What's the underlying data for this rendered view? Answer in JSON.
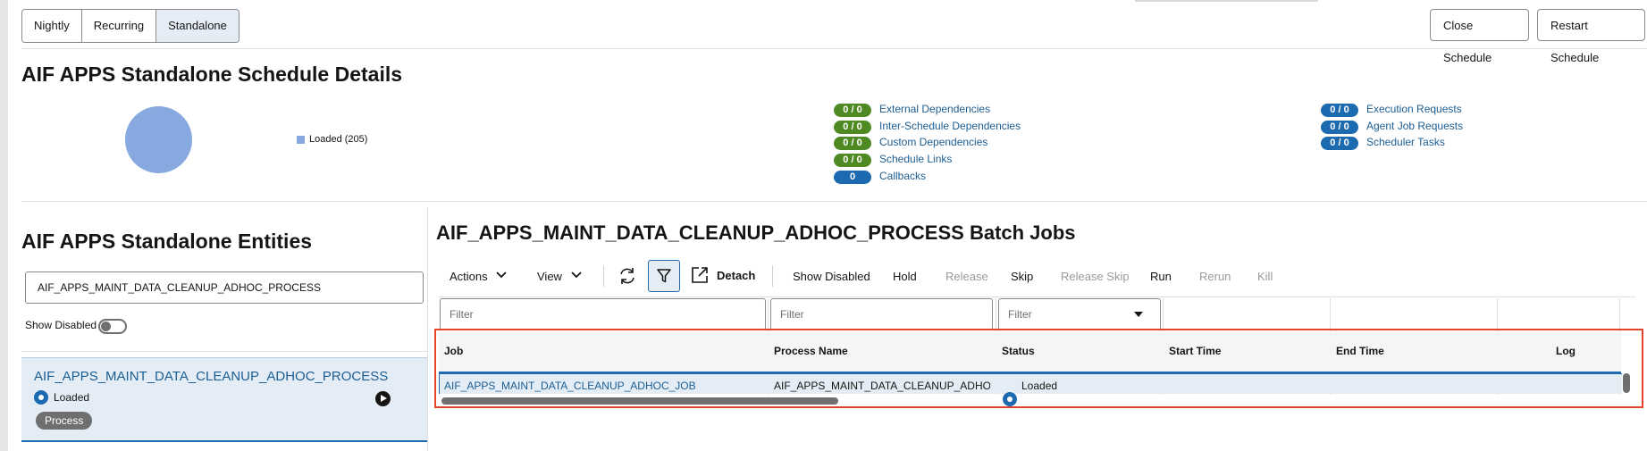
{
  "tabs": [
    "Nightly",
    "Recurring",
    "Standalone"
  ],
  "header_actions": {
    "close": "Close Schedule",
    "restart": "Restart Schedule"
  },
  "schedule_details": {
    "title": "AIF APPS Standalone Schedule Details",
    "legend": "Loaded (205)",
    "dependencies_left": [
      {
        "count": "0 / 0",
        "label": "External Dependencies",
        "color": "#4e8a21"
      },
      {
        "count": "0 / 0",
        "label": "Inter-Schedule Dependencies",
        "color": "#4e8a21"
      },
      {
        "count": "0 / 0",
        "label": "Custom Dependencies",
        "color": "#4e8a21"
      },
      {
        "count": "0 / 0",
        "label": "Schedule Links",
        "color": "#4e8a21"
      },
      {
        "count": "0",
        "label": "Callbacks",
        "color": "#1c6ab0"
      }
    ],
    "dependencies_right": [
      {
        "count": "0 / 0",
        "label": "Execution Requests",
        "color": "#1c6ab0"
      },
      {
        "count": "0 / 0",
        "label": "Agent Job Requests",
        "color": "#1c6ab0"
      },
      {
        "count": "0 / 0",
        "label": "Scheduler Tasks",
        "color": "#1c6ab0"
      }
    ]
  },
  "entities": {
    "title": "AIF APPS Standalone Entities",
    "search_value": "AIF_APPS_MAINT_DATA_CLEANUP_ADHOC_PROCESS",
    "show_disabled_label": "Show Disabled",
    "card": {
      "name": "AIF_APPS_MAINT_DATA_CLEANUP_ADHOC_PROCESS",
      "status": "Loaded",
      "type": "Process"
    }
  },
  "batch": {
    "title": "AIF_APPS_MAINT_DATA_CLEANUP_ADHOC_PROCESS Batch Jobs",
    "toolbar": {
      "actions": "Actions",
      "view": "View",
      "detach": "Detach",
      "show_disabled": "Show Disabled",
      "hold": "Hold",
      "release": "Release",
      "skip": "Skip",
      "release_skip": "Release Skip",
      "run": "Run",
      "rerun": "Rerun",
      "kill": "Kill"
    },
    "filter_placeholder": "Filter",
    "columns": [
      "Job",
      "Process Name",
      "Status",
      "Start Time",
      "End Time",
      "Log"
    ],
    "rows": [
      {
        "job": "AIF_APPS_MAINT_DATA_CLEANUP_ADHOC_JOB",
        "process": "AIF_APPS_MAINT_DATA_CLEANUP_ADHO...",
        "status": "Loaded",
        "start": "",
        "end": "",
        "log": ""
      }
    ]
  },
  "colors": {
    "accent": "#1c6ab0",
    "link": "#1c5d92",
    "highlight": "#e2442b",
    "pie": "#88a8e0"
  }
}
